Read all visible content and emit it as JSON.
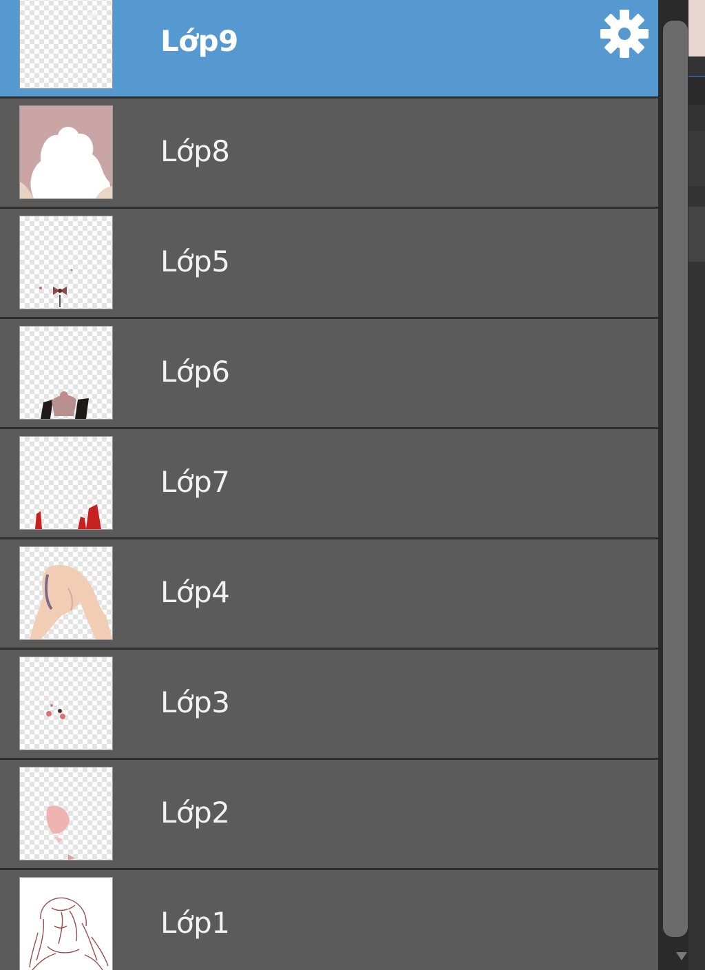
{
  "layers_panel": {
    "layers": [
      {
        "name": "Lớp9",
        "selected": true,
        "thumb": "blank-layer"
      },
      {
        "name": "Lớp8",
        "selected": false,
        "thumb": "pink-cloud-background"
      },
      {
        "name": "Lớp5",
        "selected": false,
        "thumb": "small-bow-ornament"
      },
      {
        "name": "Lớp6",
        "selected": false,
        "thumb": "dark-collar-shapes"
      },
      {
        "name": "Lớp7",
        "selected": false,
        "thumb": "red-shapes"
      },
      {
        "name": "Lớp4",
        "selected": false,
        "thumb": "skin-tone-figure"
      },
      {
        "name": "Lớp3",
        "selected": false,
        "thumb": "red-dots"
      },
      {
        "name": "Lớp2",
        "selected": false,
        "thumb": "pink-blush"
      },
      {
        "name": "Lớp1",
        "selected": false,
        "thumb": "line-art-sketch"
      }
    ],
    "settings_icon": "gear-icon"
  },
  "colors": {
    "selected_row": "#5599d0",
    "row": "#5b5b5b",
    "separator": "#2e2e2e",
    "text": "#f2f2f2"
  }
}
